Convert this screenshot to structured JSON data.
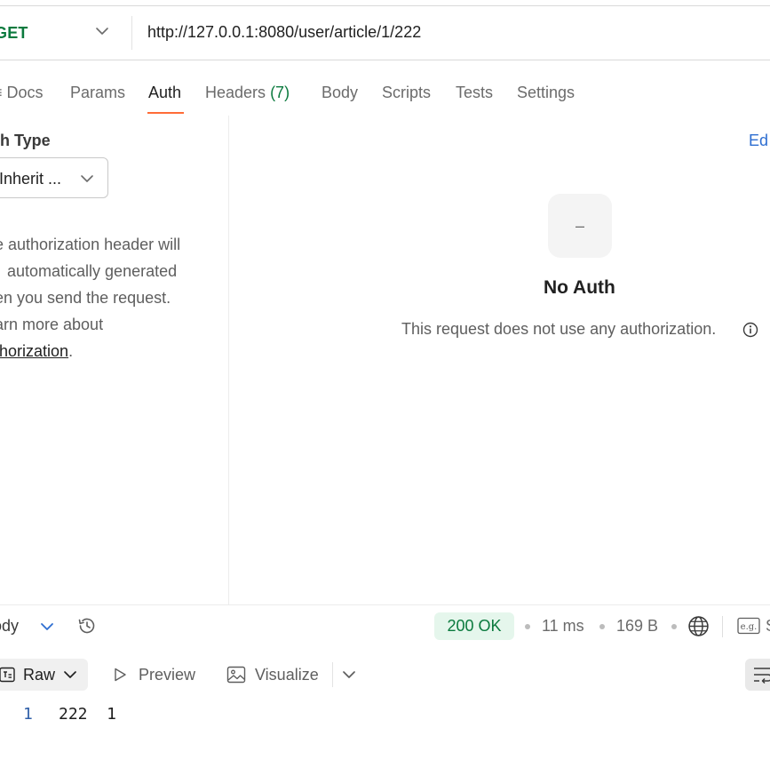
{
  "request": {
    "method": "GET",
    "url": "http://127.0.0.1:8080/user/article/1/222"
  },
  "tabs": [
    {
      "label": "Docs",
      "count": ""
    },
    {
      "label": "Params",
      "count": ""
    },
    {
      "label": "Auth",
      "count": "",
      "active": true
    },
    {
      "label": "Headers",
      "count": "(7)"
    },
    {
      "label": "Body",
      "count": ""
    },
    {
      "label": "Scripts",
      "count": ""
    },
    {
      "label": "Tests",
      "count": ""
    },
    {
      "label": "Settings",
      "count": ""
    }
  ],
  "docs_prefix": "≡",
  "auth": {
    "type_label": "th Type",
    "type_value": "Inherit ...",
    "description_lines": [
      "e authorization header will",
      "automatically generated",
      "en you send the request.",
      "arn more about"
    ],
    "link_text": "thorization",
    "link_suffix": ".",
    "edit_link": "Ed",
    "empty_icon_glyph": "–",
    "empty_title": "No Auth",
    "empty_description": "This request does not use any authorization."
  },
  "response": {
    "body_label": "ody",
    "status": "200 OK",
    "time": "11 ms",
    "size": "169 B",
    "example_icon_text": "e.g.",
    "example_next_text": "S",
    "status_color": "#0b7a3e",
    "status_bg": "#e5f6ec"
  },
  "view": {
    "raw_label": "Raw",
    "preview_label": "Preview",
    "visualize_label": "Visualize"
  },
  "editor": {
    "line_number": "1",
    "line_text": "222  1"
  },
  "colors": {
    "accent": "#ff6c37",
    "method_get": "#0b7a3e",
    "link": "#2e6ed1"
  }
}
